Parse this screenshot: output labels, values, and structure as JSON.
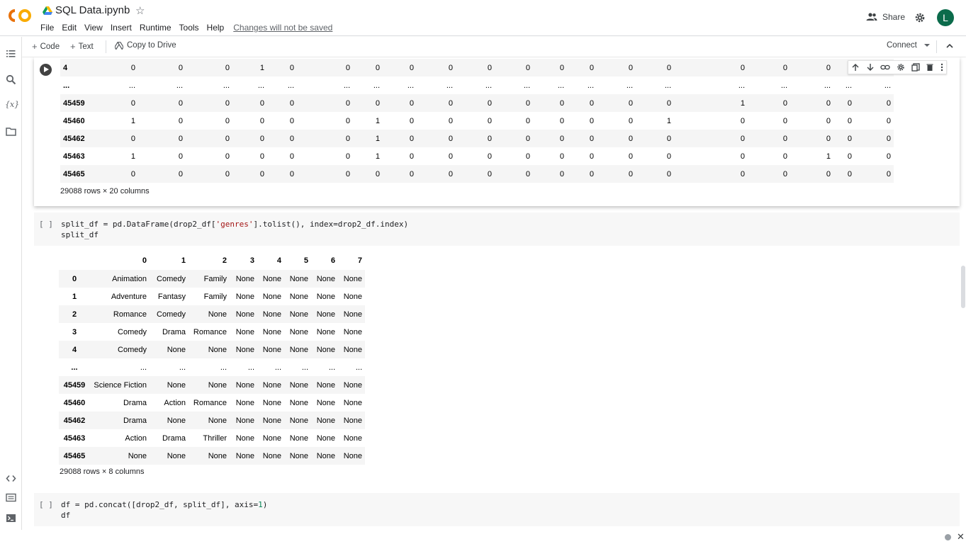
{
  "header": {
    "logo": "CO",
    "title": "SQL Data.ipynb",
    "menu": [
      "File",
      "Edit",
      "View",
      "Insert",
      "Runtime",
      "Tools",
      "Help"
    ],
    "unsaved": "Changes will not be saved",
    "share": "Share",
    "avatar": "L"
  },
  "toolbar": {
    "code": "Code",
    "text": "Text",
    "copy_to_drive": "Copy to Drive",
    "connect": "Connect"
  },
  "cell1": {
    "rows": [
      {
        "idx": "4",
        "vals": [
          "0",
          "0",
          "0",
          "1",
          "0",
          "0",
          "0",
          "0",
          "0",
          "0",
          "0",
          "0",
          "0",
          "0",
          "0",
          "0",
          "0",
          "0",
          "0",
          ""
        ]
      },
      {
        "idx": "...",
        "vals": [
          "...",
          "...",
          "...",
          "...",
          "...",
          "...",
          "...",
          "...",
          "...",
          "...",
          "...",
          "...",
          "...",
          "...",
          "...",
          "...",
          "...",
          "...",
          "...",
          "..."
        ]
      },
      {
        "idx": "45459",
        "vals": [
          "0",
          "0",
          "0",
          "0",
          "0",
          "0",
          "0",
          "0",
          "0",
          "0",
          "0",
          "0",
          "0",
          "0",
          "0",
          "1",
          "0",
          "0",
          "0",
          "0"
        ]
      },
      {
        "idx": "45460",
        "vals": [
          "1",
          "0",
          "0",
          "0",
          "0",
          "0",
          "1",
          "0",
          "0",
          "0",
          "0",
          "0",
          "0",
          "0",
          "1",
          "0",
          "0",
          "0",
          "0",
          "0"
        ]
      },
      {
        "idx": "45462",
        "vals": [
          "0",
          "0",
          "0",
          "0",
          "0",
          "0",
          "1",
          "0",
          "0",
          "0",
          "0",
          "0",
          "0",
          "0",
          "0",
          "0",
          "0",
          "0",
          "0",
          "0"
        ]
      },
      {
        "idx": "45463",
        "vals": [
          "1",
          "0",
          "0",
          "0",
          "0",
          "0",
          "1",
          "0",
          "0",
          "0",
          "0",
          "0",
          "0",
          "0",
          "0",
          "0",
          "0",
          "1",
          "0",
          "0"
        ]
      },
      {
        "idx": "45465",
        "vals": [
          "0",
          "0",
          "0",
          "0",
          "0",
          "0",
          "0",
          "0",
          "0",
          "0",
          "0",
          "0",
          "0",
          "0",
          "0",
          "0",
          "0",
          "0",
          "0",
          "0"
        ]
      }
    ],
    "caption": "29088 rows × 20 columns"
  },
  "cell2": {
    "brackets": "[ ]",
    "code_line1_a": "split_df = pd.DataFrame(drop2_df[",
    "code_line1_str": "'genres'",
    "code_line1_b": "].tolist(), index=drop2_df.index)",
    "code_line2": "split_df",
    "columns": [
      "0",
      "1",
      "2",
      "3",
      "4",
      "5",
      "6",
      "7"
    ],
    "rows": [
      {
        "idx": "0",
        "vals": [
          "Animation",
          "Comedy",
          "Family",
          "None",
          "None",
          "None",
          "None",
          "None"
        ]
      },
      {
        "idx": "1",
        "vals": [
          "Adventure",
          "Fantasy",
          "Family",
          "None",
          "None",
          "None",
          "None",
          "None"
        ]
      },
      {
        "idx": "2",
        "vals": [
          "Romance",
          "Comedy",
          "None",
          "None",
          "None",
          "None",
          "None",
          "None"
        ]
      },
      {
        "idx": "3",
        "vals": [
          "Comedy",
          "Drama",
          "Romance",
          "None",
          "None",
          "None",
          "None",
          "None"
        ]
      },
      {
        "idx": "4",
        "vals": [
          "Comedy",
          "None",
          "None",
          "None",
          "None",
          "None",
          "None",
          "None"
        ]
      },
      {
        "idx": "...",
        "vals": [
          "...",
          "...",
          "...",
          "...",
          "...",
          "...",
          "...",
          "..."
        ]
      },
      {
        "idx": "45459",
        "vals": [
          "Science Fiction",
          "None",
          "None",
          "None",
          "None",
          "None",
          "None",
          "None"
        ]
      },
      {
        "idx": "45460",
        "vals": [
          "Drama",
          "Action",
          "Romance",
          "None",
          "None",
          "None",
          "None",
          "None"
        ]
      },
      {
        "idx": "45462",
        "vals": [
          "Drama",
          "None",
          "None",
          "None",
          "None",
          "None",
          "None",
          "None"
        ]
      },
      {
        "idx": "45463",
        "vals": [
          "Action",
          "Drama",
          "Thriller",
          "None",
          "None",
          "None",
          "None",
          "None"
        ]
      },
      {
        "idx": "45465",
        "vals": [
          "None",
          "None",
          "None",
          "None",
          "None",
          "None",
          "None",
          "None"
        ]
      }
    ],
    "caption": "29088 rows × 8 columns"
  },
  "cell3": {
    "brackets": "[ ]",
    "code_line1_a": "df = pd.concat([drop2_df, split_df], axis=",
    "code_line1_num": "1",
    "code_line1_b": ")",
    "code_line2": "df"
  },
  "colors": {
    "logo_orange": "#f9ab00",
    "avatar_bg": "#0b6b4b",
    "string_literal": "#a31515",
    "number_literal": "#098658"
  }
}
